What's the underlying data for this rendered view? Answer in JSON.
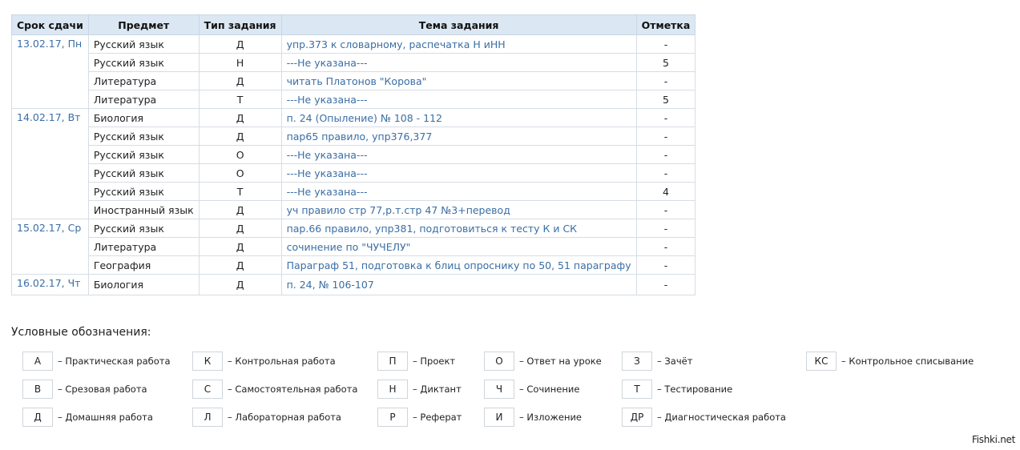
{
  "table": {
    "headers": [
      "Срок сдачи",
      "Предмет",
      "Тип задания",
      "Тема задания",
      "Отметка"
    ],
    "rows": [
      {
        "date": "13.02.17, Пн",
        "subject": "Русский язык",
        "type": "Д",
        "topic": "упр.373 к словарному, распечатка Н иНН",
        "mark": "-"
      },
      {
        "date": "",
        "subject": "Русский язык",
        "type": "Н",
        "topic": "---Не указана---",
        "mark": "5"
      },
      {
        "date": "",
        "subject": "Литература",
        "type": "Д",
        "topic": "читать Платонов \"Корова\"",
        "mark": "-"
      },
      {
        "date": "",
        "subject": "Литература",
        "type": "Т",
        "topic": "---Не указана---",
        "mark": "5"
      },
      {
        "date": "14.02.17, Вт",
        "subject": "Биология",
        "type": "Д",
        "topic": "п. 24 (Опыление) № 108 - 112",
        "mark": "-"
      },
      {
        "date": "",
        "subject": "Русский язык",
        "type": "Д",
        "topic": "пар65 правило, упр376,377",
        "mark": "-"
      },
      {
        "date": "",
        "subject": "Русский язык",
        "type": "О",
        "topic": "---Не указана---",
        "mark": "-"
      },
      {
        "date": "",
        "subject": "Русский язык",
        "type": "О",
        "topic": "---Не указана---",
        "mark": "-"
      },
      {
        "date": "",
        "subject": "Русский язык",
        "type": "Т",
        "topic": "---Не указана---",
        "mark": "4"
      },
      {
        "date": "",
        "subject": "Иностранный язык",
        "type": "Д",
        "topic": "уч правило стр 77,р.т.стр 47 №3+перевод",
        "mark": "-"
      },
      {
        "date": "15.02.17, Ср",
        "subject": "Русский язык",
        "type": "Д",
        "topic": "пар.66 правило, упр381, подготовиться к тесту К и СК",
        "mark": "-"
      },
      {
        "date": "",
        "subject": "Литература",
        "type": "Д",
        "topic": "сочинение по \"ЧУЧЕЛУ\"",
        "mark": "-"
      },
      {
        "date": "",
        "subject": "География",
        "type": "Д",
        "topic": "Параграф 51, подготовка к блиц опроснику по 50, 51 параграфу",
        "mark": "-"
      },
      {
        "date": "16.02.17, Чт",
        "subject": "Биология",
        "type": "Д",
        "topic": "п. 24, № 106-107",
        "mark": "-"
      }
    ]
  },
  "legend": {
    "title": "Условные обозначения:",
    "items": [
      {
        "code": "А",
        "label": "– Практическая работа"
      },
      {
        "code": "В",
        "label": "– Срезовая работа"
      },
      {
        "code": "Д",
        "label": "– Домашняя работа"
      },
      {
        "code": "К",
        "label": "– Контрольная работа"
      },
      {
        "code": "С",
        "label": "– Самостоятельная работа"
      },
      {
        "code": "Л",
        "label": "– Лабораторная работа"
      },
      {
        "code": "П",
        "label": "– Проект"
      },
      {
        "code": "Н",
        "label": "– Диктант"
      },
      {
        "code": "Р",
        "label": "– Реферат"
      },
      {
        "code": "О",
        "label": "– Ответ на уроке"
      },
      {
        "code": "Ч",
        "label": "– Сочинение"
      },
      {
        "code": "И",
        "label": "– Изложение"
      },
      {
        "code": "З",
        "label": "– Зачёт"
      },
      {
        "code": "Т",
        "label": "– Тестирование"
      },
      {
        "code": "ДР",
        "label": "– Диагностическая работа"
      },
      {
        "code": "КС",
        "label": "– Контрольное списывание"
      }
    ]
  },
  "watermark": "Fishki.net",
  "colors": {
    "header_bg": "#dbe7f3",
    "link": "#3a6ea5",
    "border": "#d6dde5"
  }
}
